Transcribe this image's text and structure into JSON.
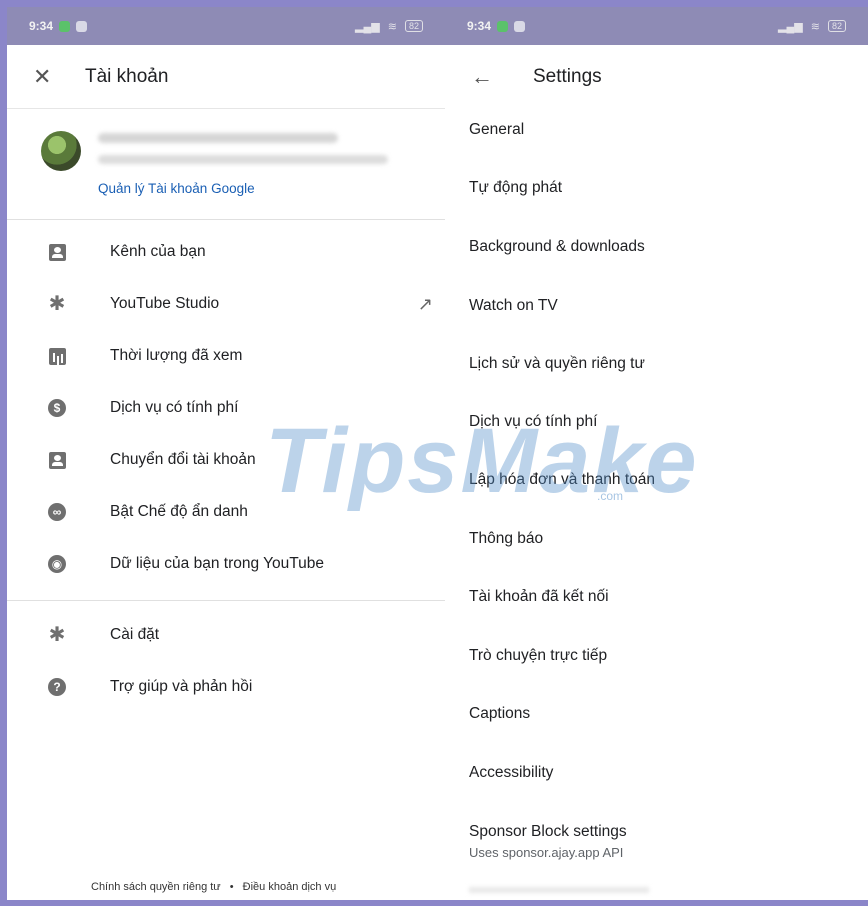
{
  "left": {
    "status_time": "9:34",
    "battery": "82",
    "title": "Tài khoản",
    "manage_link": "Quản lý Tài khoản Google",
    "menu": [
      {
        "label": "Kênh của bạn"
      },
      {
        "label": "YouTube Studio"
      },
      {
        "label": "Thời lượng đã xem"
      },
      {
        "label": "Dịch vụ có tính phí"
      },
      {
        "label": "Chuyển đổi tài khoản"
      },
      {
        "label": "Bật Chế độ ẩn danh"
      },
      {
        "label": "Dữ liệu của bạn trong YouTube"
      }
    ],
    "menu2": [
      {
        "label": "Cài đặt"
      },
      {
        "label": "Trợ giúp và phản hồi"
      }
    ],
    "footer": {
      "privacy": "Chính sách quyền riêng tư",
      "dot": "•",
      "terms": "Điều khoản dịch vụ"
    }
  },
  "right": {
    "status_time": "9:34",
    "battery": "82",
    "title": "Settings",
    "items": [
      {
        "label": "General"
      },
      {
        "label": "Tự động phát"
      },
      {
        "label": "Background & downloads"
      },
      {
        "label": "Watch on TV"
      },
      {
        "label": "Lịch sử và quyền riêng tư"
      },
      {
        "label": "Dịch vụ có tính phí"
      },
      {
        "label": "Lập hóa đơn và thanh toán"
      },
      {
        "label": "Thông báo"
      },
      {
        "label": "Tài khoản đã kết nối"
      },
      {
        "label": "Trò chuyện trực tiếp"
      },
      {
        "label": "Captions"
      },
      {
        "label": "Accessibility"
      },
      {
        "label": "Sponsor Block settings",
        "sub": "Uses sponsor.ajay.app API"
      }
    ]
  },
  "watermark": {
    "text": "TipsMake",
    "sub": ".com"
  },
  "colors": {
    "link": "#1a5fb4",
    "statusbar": "#8e8bb5",
    "border": "#8b86c9"
  }
}
